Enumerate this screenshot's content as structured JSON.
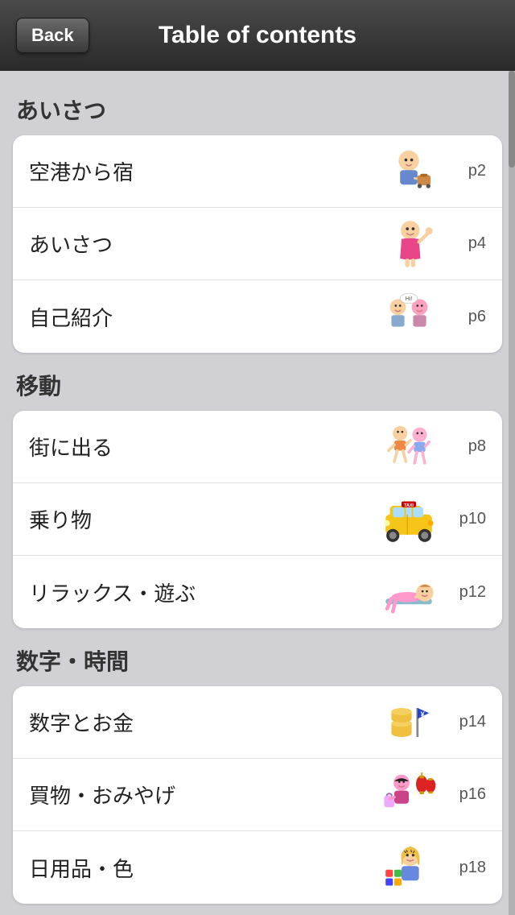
{
  "header": {
    "back_label": "Back",
    "title": "Table of contents"
  },
  "sections": [
    {
      "id": "section-greetings",
      "heading": "あいさつ",
      "items": [
        {
          "id": "item-airport",
          "text": "空港から宿",
          "page": "p2",
          "emoji": "✈️🏨"
        },
        {
          "id": "item-greetings",
          "text": "あいさつ",
          "page": "p4",
          "emoji": "👋"
        },
        {
          "id": "item-selfintro",
          "text": "自己紹介",
          "page": "p6",
          "emoji": "🤝"
        }
      ]
    },
    {
      "id": "section-travel",
      "heading": "移動",
      "items": [
        {
          "id": "item-gotown",
          "text": "街に出る",
          "page": "p8",
          "emoji": "🚶"
        },
        {
          "id": "item-transport",
          "text": "乗り物",
          "page": "p10",
          "emoji": "🚕"
        },
        {
          "id": "item-relax",
          "text": "リラックス・遊ぶ",
          "page": "p12",
          "emoji": "🏖️"
        }
      ]
    },
    {
      "id": "section-numbers",
      "heading": "数字・時間",
      "items": [
        {
          "id": "item-money",
          "text": "数字とお金",
          "page": "p14",
          "emoji": "💰"
        },
        {
          "id": "item-shopping",
          "text": "買物・おみやげ",
          "page": "p16",
          "emoji": "🛍️"
        },
        {
          "id": "item-daily",
          "text": "日用品・色",
          "page": "p18",
          "emoji": "🎨"
        }
      ]
    }
  ]
}
